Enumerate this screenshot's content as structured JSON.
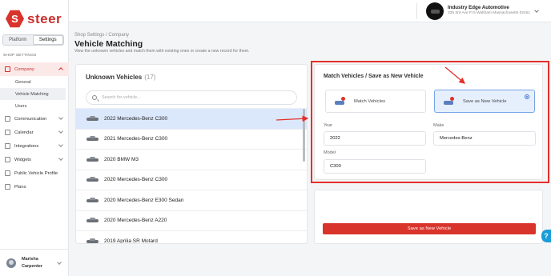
{
  "brand": {
    "name": "steer",
    "hex_letter": "S"
  },
  "sidebar": {
    "toggle": {
      "platform": "Platform",
      "settings": "Settings"
    },
    "section_label": "SHOP SETTINGS",
    "company": "Company",
    "company_sub": [
      "General",
      "Vehicle Matching",
      "Users"
    ],
    "communication": "Communication",
    "calendar": "Calendar",
    "integrations": "Integrations",
    "widgets": "Widgets",
    "public_profile": "Public Vehicle Profile",
    "plans": "Plans"
  },
  "user": {
    "first_name": "Marisha",
    "last_name": "Carpenter"
  },
  "topbar": {
    "shop_name": "Industry Edge Automotive",
    "shop_address": "336 3rd Ave Fl 5 Waltham Massachusetts 02451"
  },
  "header": {
    "breadcrumb": "Shop Settings / Company",
    "title": "Vehicle Matching",
    "description": "View the unknown vehicles and match them with existing ones or create a new record for them."
  },
  "unknown": {
    "title": "Unknown Vehicles",
    "count": "(17)",
    "search_placeholder": "Search for vehicle...",
    "vehicles": [
      "2022 Mercedes-Benz C300",
      "2021 Mercedes-Benz C300",
      "2020 BMW M3",
      "2020 Mercedes-Benz C300",
      "2020 Mercedes-Benz E300 Sedan",
      "2020 Mercedes-Benz A220",
      "2019 Aprilia SR Motard"
    ]
  },
  "match": {
    "title": "Match Vehicles / Save as New Vehicle",
    "option_match": "Match Vehicles",
    "option_save": "Save as New Vehicle",
    "year_label": "Year",
    "year_value": "2022",
    "make_label": "Make",
    "make_value": "Mercedes-Benz",
    "model_label": "Model",
    "model_value": "C300",
    "save_button": "Save as New Vehicle"
  },
  "help": "?",
  "colors": {
    "brand_red": "#d9342b",
    "selected_row": "#dbe8fb",
    "selected_option": "#e6effc",
    "annotation": "#e4302a"
  }
}
